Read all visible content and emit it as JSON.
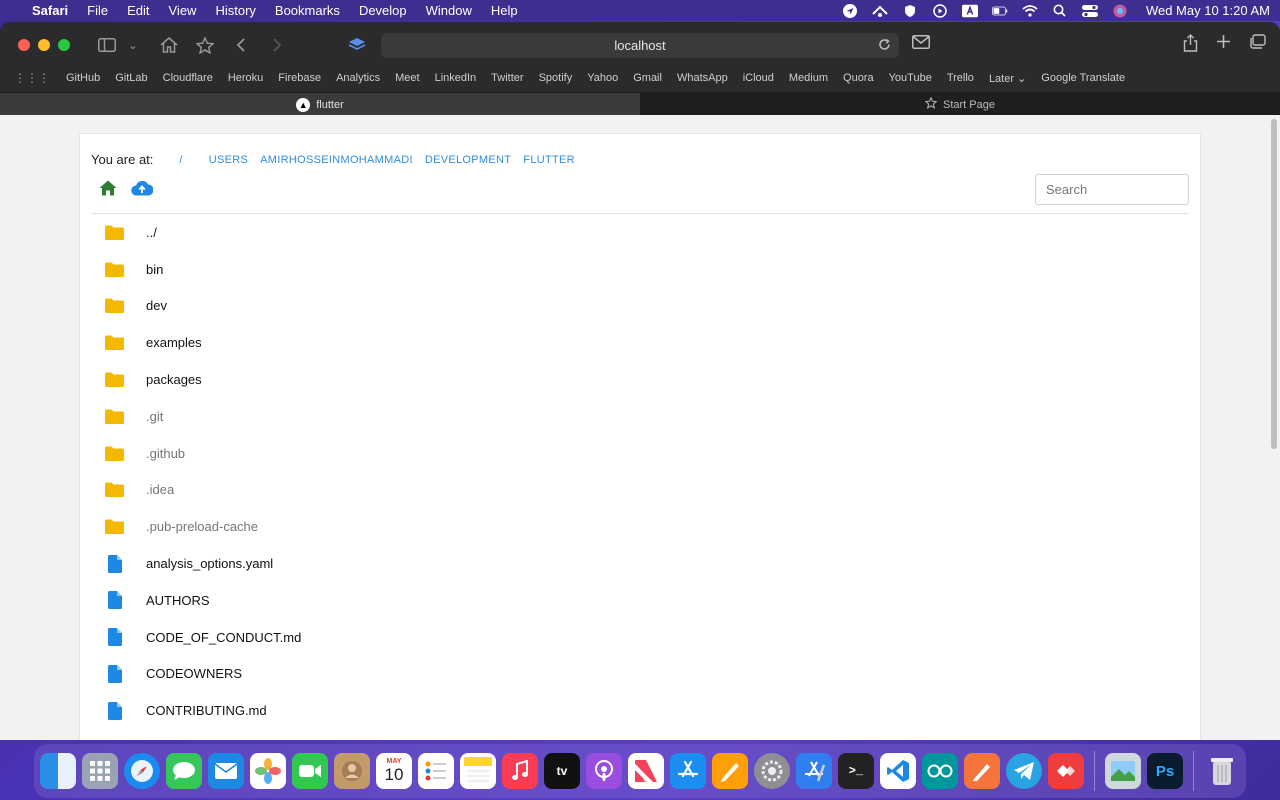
{
  "menubar": {
    "app": "Safari",
    "items": [
      "File",
      "Edit",
      "View",
      "History",
      "Bookmarks",
      "Develop",
      "Window",
      "Help"
    ],
    "clock": "Wed May 10  1:20 AM"
  },
  "browser": {
    "address": "localhost",
    "favorites": [
      "GitHub",
      "GitLab",
      "Cloudflare",
      "Heroku",
      "Firebase",
      "Analytics",
      "Meet",
      "LinkedIn",
      "Twitter",
      "Spotify",
      "Yahoo",
      "Gmail",
      "WhatsApp",
      "iCloud",
      "Medium",
      "Quora",
      "YouTube",
      "Trello",
      "Later ⌄",
      "Google Translate"
    ],
    "tabs": [
      {
        "title": "flutter",
        "active": true
      },
      {
        "title": "Start Page",
        "active": false
      }
    ]
  },
  "page": {
    "breadcrumb_label": "You are at:",
    "breadcrumb": [
      "/",
      "USERS",
      "AMIRHOSSEINMOHAMMADI",
      "DEVELOPMENT",
      "FLUTTER"
    ],
    "search_placeholder": "Search",
    "entries": [
      {
        "name": "../",
        "type": "folder",
        "hidden": false
      },
      {
        "name": "bin",
        "type": "folder",
        "hidden": false
      },
      {
        "name": "dev",
        "type": "folder",
        "hidden": false
      },
      {
        "name": "examples",
        "type": "folder",
        "hidden": false
      },
      {
        "name": "packages",
        "type": "folder",
        "hidden": false
      },
      {
        "name": ".git",
        "type": "folder",
        "hidden": true
      },
      {
        "name": ".github",
        "type": "folder",
        "hidden": true
      },
      {
        "name": ".idea",
        "type": "folder",
        "hidden": true
      },
      {
        "name": ".pub-preload-cache",
        "type": "folder",
        "hidden": true
      },
      {
        "name": "analysis_options.yaml",
        "type": "file",
        "hidden": false
      },
      {
        "name": "AUTHORS",
        "type": "file",
        "hidden": false
      },
      {
        "name": "CODE_OF_CONDUCT.md",
        "type": "file",
        "hidden": false
      },
      {
        "name": "CODEOWNERS",
        "type": "file",
        "hidden": false
      },
      {
        "name": "CONTRIBUTING.md",
        "type": "file",
        "hidden": false
      }
    ]
  },
  "colors": {
    "folder": "#f5b800",
    "file": "#1e88e5",
    "link": "#2f8ee0",
    "home": "#2e7d32",
    "upload": "#1e88e5"
  },
  "dock": {
    "calendar_month": "MAY",
    "calendar_day": "10",
    "apps": [
      "finder-icon",
      "launchpad-icon",
      "safari-icon",
      "messages-icon",
      "mail-icon",
      "photos-icon",
      "facetime-icon",
      "contacts-icon",
      "calendar-icon",
      "reminders-icon",
      "notes-icon",
      "music-icon",
      "appletv-icon",
      "podcasts-icon",
      "news-icon",
      "appstore-icon",
      "pages-icon",
      "settings-icon",
      "xcode-icon",
      "terminal-icon",
      "vscode-icon",
      "arduino-icon",
      "pencil-icon",
      "telegram-icon",
      "anydesk-icon",
      "preview-icon",
      "photoshop-icon",
      "trash-icon"
    ]
  }
}
